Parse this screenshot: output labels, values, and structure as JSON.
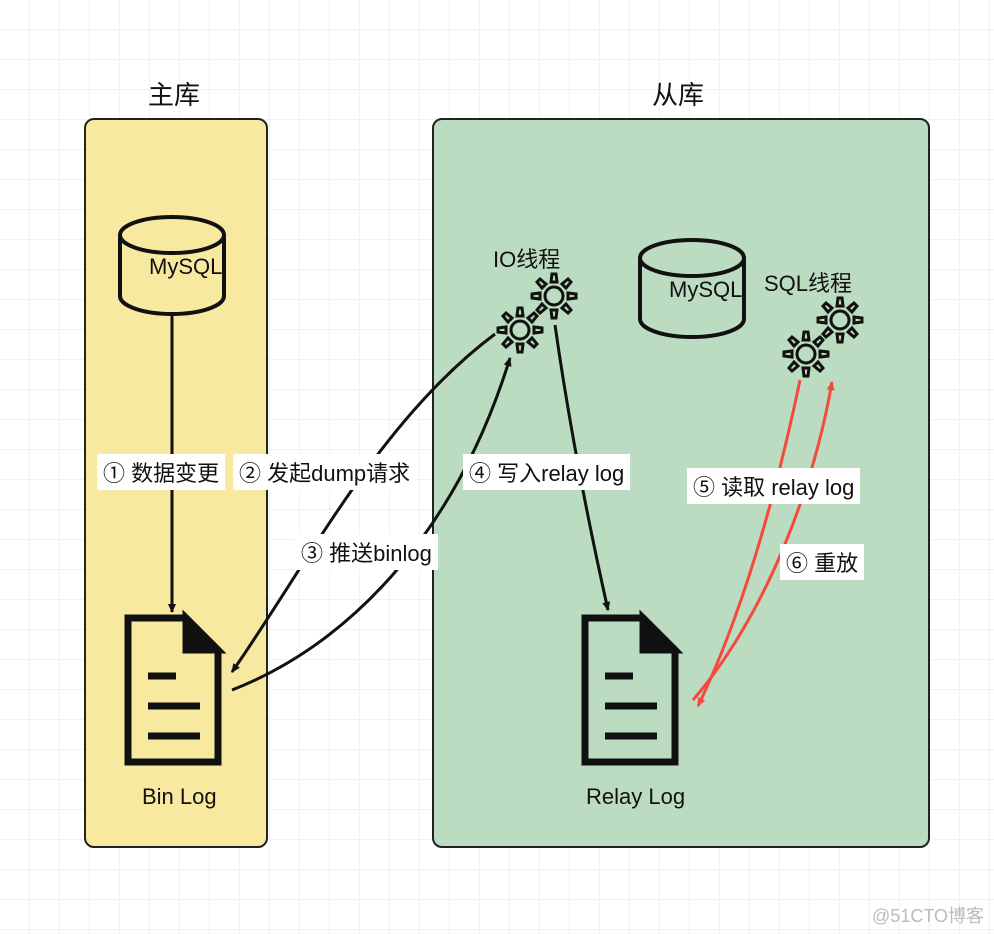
{
  "titles": {
    "master": "主库",
    "slave": "从库"
  },
  "nodes": {
    "master_mysql": "MySQL",
    "slave_mysql": "MySQL",
    "io_thread": "IO线程",
    "sql_thread": "SQL线程",
    "binlog": "Bin Log",
    "relaylog": "Relay Log"
  },
  "edges": {
    "e1": "① 数据变更",
    "e2": "② 发起dump请求",
    "e3": "③ 推送binlog",
    "e4": "④ 写入relay log",
    "e5": "⑤ 读取 relay log",
    "e6": "⑥ 重放"
  },
  "colors": {
    "master_fill": "#f7e9a0",
    "slave_fill": "#bbdcc0",
    "border": "#222222",
    "arrow": "#111111",
    "red": "#f44a3d"
  },
  "watermark": "@51CTO博客"
}
